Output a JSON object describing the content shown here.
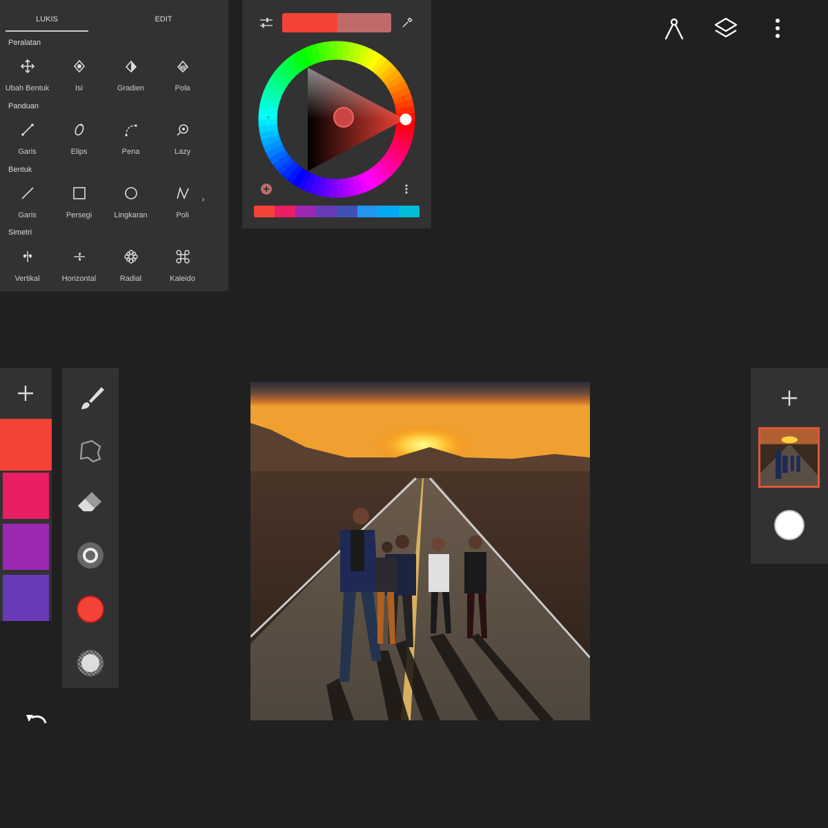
{
  "tabs": {
    "paint": "LUKIS",
    "edit": "EDIT"
  },
  "sections": {
    "tools": "Peralatan",
    "guides": "Panduan",
    "shapes": "Bentuk",
    "symmetry": "Simetri"
  },
  "tools": [
    {
      "label": "Ubah Bentuk",
      "icon": "move-icon"
    },
    {
      "label": "Isi",
      "icon": "fill-icon"
    },
    {
      "label": "Gradien",
      "icon": "gradient-icon"
    },
    {
      "label": "Pola",
      "icon": "pattern-icon"
    }
  ],
  "guides": [
    {
      "label": "Garis",
      "icon": "guide-line-icon"
    },
    {
      "label": "Elips",
      "icon": "ellipse-icon"
    },
    {
      "label": "Pena",
      "icon": "pen-curve-icon"
    },
    {
      "label": "Lazy",
      "icon": "lazy-icon"
    }
  ],
  "shapes": [
    {
      "label": "Garis",
      "icon": "line-icon"
    },
    {
      "label": "Persegi",
      "icon": "square-icon"
    },
    {
      "label": "Lingkaran",
      "icon": "circle-icon"
    },
    {
      "label": "Poli",
      "icon": "polyline-icon"
    }
  ],
  "symmetry": [
    {
      "label": "Vertikal",
      "icon": "vertical-symmetry-icon"
    },
    {
      "label": "Horizontal",
      "icon": "horizontal-symmetry-icon"
    },
    {
      "label": "Radial",
      "icon": "radial-symmetry-icon"
    },
    {
      "label": "Kaleido",
      "icon": "kaleido-icon"
    }
  ],
  "more_shapes_glyph": "›",
  "color": {
    "current": "#f44336",
    "previous": "#c06b6b",
    "recent": [
      "#f44336",
      "#e91e63",
      "#9c27b0",
      "#673ab7",
      "#3f51b5",
      "#2196f3",
      "#03a9f4",
      "#00bcd4"
    ]
  },
  "palette": [
    "#f44336",
    "#e91e63",
    "#9c27b0",
    "#673ab7"
  ],
  "top_icons": [
    "compass-ruler-icon",
    "layers-icon",
    "more-vert-icon"
  ]
}
